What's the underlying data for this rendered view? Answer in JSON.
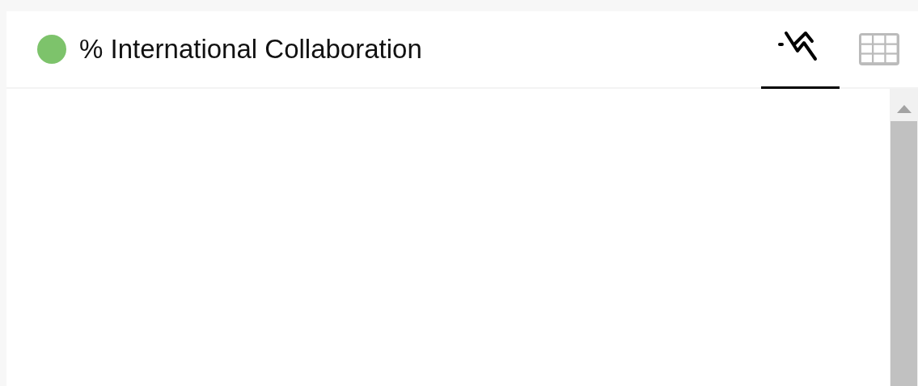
{
  "panel": {
    "title": "% International Collaboration",
    "color": "#7dc36b",
    "tabs": [
      {
        "kind": "chart",
        "selected": true
      },
      {
        "kind": "table",
        "selected": false
      }
    ]
  }
}
